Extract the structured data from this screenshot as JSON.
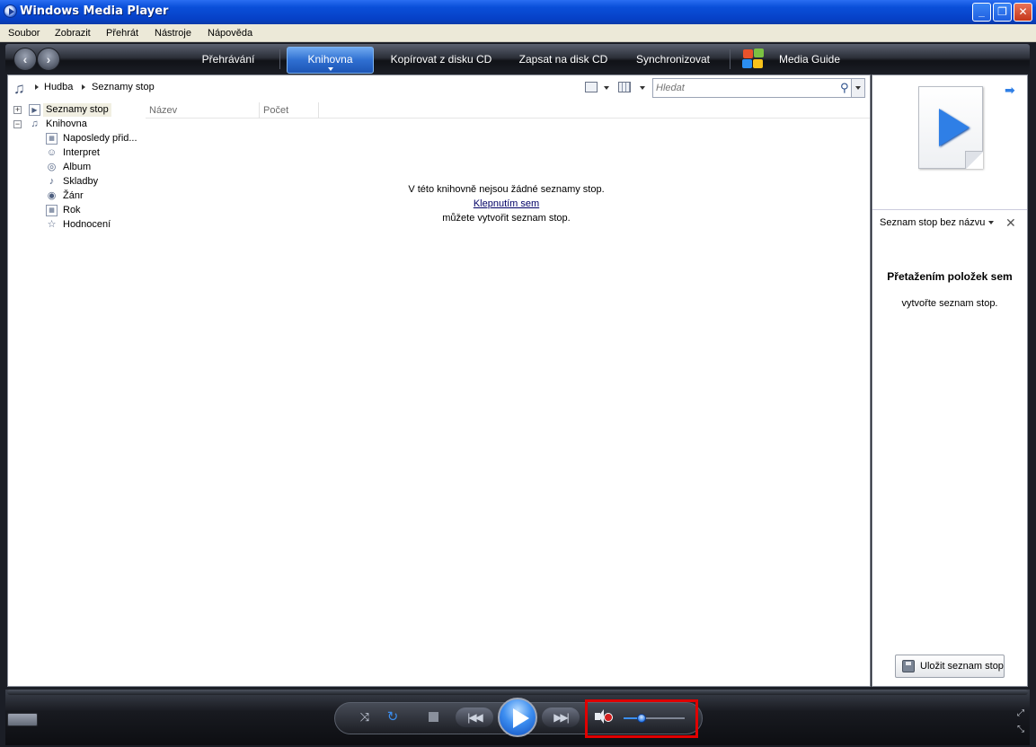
{
  "window": {
    "title": "Windows Media Player"
  },
  "menu": [
    "Soubor",
    "Zobrazit",
    "Přehrát",
    "Nástroje",
    "Nápověda"
  ],
  "nav": {
    "tabs": [
      {
        "label": "Přehrávání"
      },
      {
        "label": "Knihovna",
        "active": true
      },
      {
        "label": "Kopírovat z disku CD"
      },
      {
        "label": "Zapsat na disk CD"
      },
      {
        "label": "Synchronizovat"
      },
      {
        "label": "Media Guide"
      }
    ]
  },
  "address": {
    "breadcrumbs": [
      "Hudba",
      "Seznamy stop"
    ],
    "search_placeholder": "Hledat"
  },
  "tree": {
    "items": [
      {
        "label": "Seznamy stop",
        "icon": "playlist-icon",
        "selected": true
      },
      {
        "label": "Knihovna",
        "icon": "music-library-icon"
      },
      {
        "label": "Naposledy přid...",
        "icon": "calendar-icon"
      },
      {
        "label": "Interpret",
        "icon": "artist-icon"
      },
      {
        "label": "Album",
        "icon": "album-icon"
      },
      {
        "label": "Skladby",
        "icon": "note-icon"
      },
      {
        "label": "Žánr",
        "icon": "genre-icon"
      },
      {
        "label": "Rok",
        "icon": "calendar-icon"
      },
      {
        "label": "Hodnocení",
        "icon": "star-icon"
      }
    ]
  },
  "columns": [
    "Název",
    "Počet"
  ],
  "empty_state": {
    "line1": "V této knihovně nejsou žádné seznamy stop.",
    "link": "Klepnutím sem",
    "line3": "můžete vytvořit seznam stop."
  },
  "list_pane": {
    "playlist_name": "Seznam stop bez názvu",
    "drag_title": "Přetažením položek sem",
    "drag_sub": "vytvořte seznam stop.",
    "save_label": "Uložit seznam stop"
  },
  "player": {
    "volume": 0.3,
    "muted": true
  },
  "colors": {
    "active_tab": "#2f6fd1",
    "frame": "#1b1e26",
    "highlight": "#e00000"
  }
}
